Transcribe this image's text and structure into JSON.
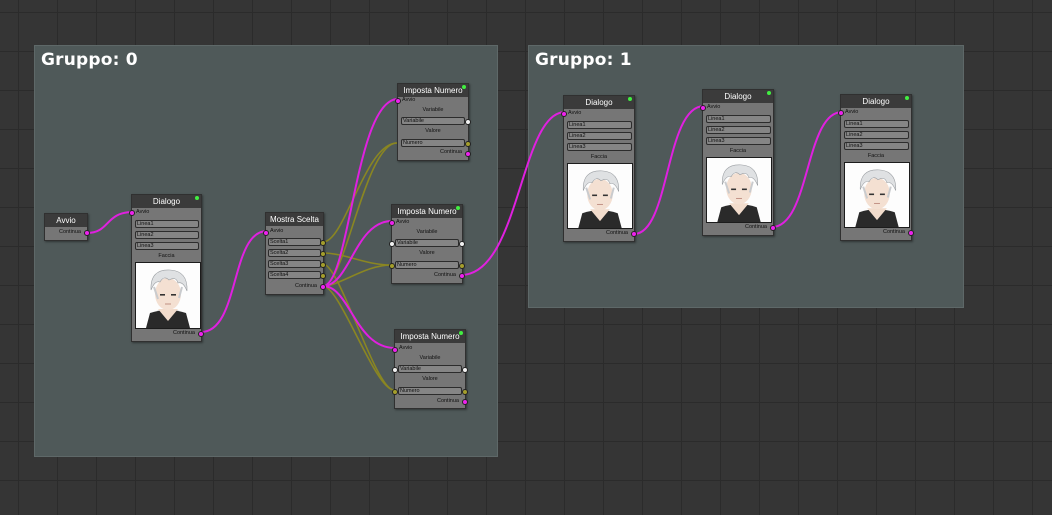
{
  "groups": [
    {
      "title": "Gruppo: 0"
    },
    {
      "title": "Gruppo: 1"
    }
  ],
  "avvio": {
    "title": "Avvio",
    "out": "Continua"
  },
  "dialogo1": {
    "title": "Dialogo",
    "in": "Avvio",
    "lines": [
      "Linea1",
      "Linea2",
      "Linea3"
    ],
    "face_label": "Faccia",
    "out": "Continua"
  },
  "mostra": {
    "title": "Mostra Scelta",
    "in": "Avvio",
    "choices": [
      "Scelta1",
      "Scelta2",
      "Scelta3",
      "Scelta4"
    ],
    "out": "Continua"
  },
  "imposta1": {
    "title": "Imposta Numero",
    "in": "Avvio",
    "var_label": "Variabile",
    "var_field": "Variabile",
    "val_label": "Valore",
    "val_field": "Numero",
    "out": "Continua"
  },
  "imposta2": {
    "title": "Imposta Numero",
    "in": "Avvio",
    "var_label": "Variabile",
    "var_field": "Variabile",
    "val_label": "Valore",
    "val_field": "Numero",
    "out": "Continua"
  },
  "imposta3": {
    "title": "Imposta Numero",
    "in": "Avvio",
    "var_label": "Variabile",
    "var_field": "Variabile",
    "val_label": "Valore",
    "val_field": "Numero",
    "out": "Continua"
  },
  "dialogo2": {
    "title": "Dialogo",
    "in": "Avvio",
    "lines": [
      "Linea1",
      "Linea2",
      "Linea3"
    ],
    "face_label": "Faccia",
    "out": "Continua"
  },
  "dialogo3": {
    "title": "Dialogo",
    "in": "Avvio",
    "lines": [
      "Linea1",
      "Linea2",
      "Linea3"
    ],
    "face_label": "Faccia",
    "out": "Continua"
  },
  "dialogo4": {
    "title": "Dialogo",
    "in": "Avvio",
    "lines": [
      "Linea1",
      "Linea2",
      "Linea3"
    ],
    "face_label": "Faccia",
    "out": "Continua"
  },
  "colors": {
    "flow_wire": "#e020e0",
    "number_wire": "#8f8a22",
    "group_bg": "#4f5959",
    "node_header": "#3b3b3b",
    "node_body": "#767676",
    "status_led": "#41ef41"
  },
  "icons": {
    "portrait": "white-haired-character-portrait",
    "status": "status-led-icon"
  }
}
